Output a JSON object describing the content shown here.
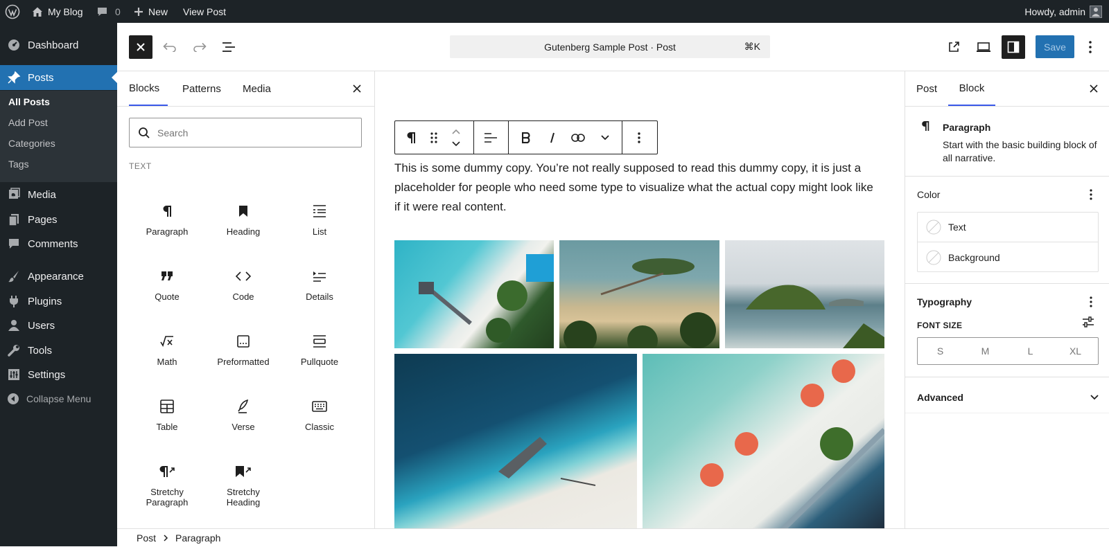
{
  "admin_bar": {
    "site_name": "My Blog",
    "comments_count": "0",
    "new_label": "New",
    "view_post_label": "View Post",
    "howdy": "Howdy, admin"
  },
  "admin_menu": {
    "dashboard": "Dashboard",
    "posts": "Posts",
    "posts_sub": [
      "All Posts",
      "Add Post",
      "Categories",
      "Tags"
    ],
    "media": "Media",
    "pages": "Pages",
    "comments": "Comments",
    "appearance": "Appearance",
    "plugins": "Plugins",
    "users": "Users",
    "tools": "Tools",
    "settings": "Settings",
    "collapse": "Collapse Menu"
  },
  "editor_header": {
    "command_title": "Gutenberg Sample Post · Post",
    "shortcut": "⌘K",
    "save_label": "Save"
  },
  "inserter": {
    "tabs": [
      "Blocks",
      "Patterns",
      "Media"
    ],
    "search_placeholder": "Search",
    "category": "TEXT",
    "blocks": [
      "Paragraph",
      "Heading",
      "List",
      "Quote",
      "Code",
      "Details",
      "Math",
      "Preformatted",
      "Pullquote",
      "Table",
      "Verse",
      "Classic",
      "Stretchy Paragraph",
      "Stretchy Heading"
    ]
  },
  "canvas": {
    "paragraph": "This is some dummy copy. You’re not really supposed to read this dummy copy, it is just a placeholder for people who need some type to visualize what the actual copy might look like if it were real content."
  },
  "sidebar": {
    "tabs": [
      "Post",
      "Block"
    ],
    "block_title": "Paragraph",
    "block_desc": "Start with the basic building block of all narrative.",
    "color_title": "Color",
    "color_items": [
      "Text",
      "Background"
    ],
    "typography_title": "Typography",
    "font_size_label": "FONT SIZE",
    "font_sizes": [
      "S",
      "M",
      "L",
      "XL"
    ],
    "advanced_title": "Advanced"
  },
  "breadcrumb": [
    "Post",
    "Paragraph"
  ],
  "colors": {
    "accent": "#3858e9",
    "admin_blue": "#2271b1",
    "admin_dark": "#1d2327",
    "save_button": "#2271b1"
  }
}
